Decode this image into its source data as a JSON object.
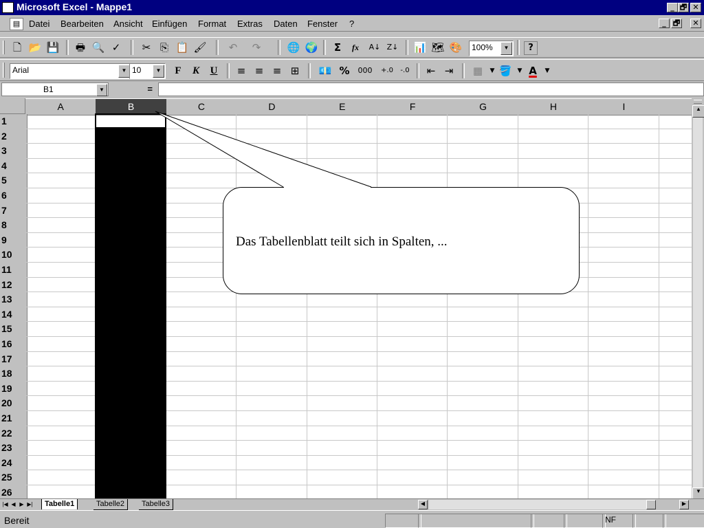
{
  "window": {
    "title": "Microsoft Excel - Mappe1",
    "controls": [
      "_",
      "🗗",
      "✕"
    ]
  },
  "menubar": {
    "items": [
      {
        "label": "Datei"
      },
      {
        "label": "Bearbeiten"
      },
      {
        "label": "Ansicht"
      },
      {
        "label": "Einfügen"
      },
      {
        "label": "Format"
      },
      {
        "label": "Extras"
      },
      {
        "label": "Daten"
      },
      {
        "label": "Fenster"
      },
      {
        "label": "?"
      }
    ]
  },
  "standard_toolbar": {
    "zoom": "100%",
    "autosum_symbol": "Σ",
    "function_symbol": "fx"
  },
  "format_toolbar": {
    "font": "Arial",
    "size": "10",
    "bold": "F",
    "italic": "K",
    "underline": "U",
    "percent": "%",
    "thousands": "000",
    "font_color_letter": "A"
  },
  "formula_bar": {
    "cell_ref": "B1",
    "equals": "="
  },
  "grid": {
    "columns": [
      "A",
      "B",
      "C",
      "D",
      "E",
      "F",
      "G",
      "H",
      "I"
    ],
    "rows": [
      "1",
      "2",
      "3",
      "4",
      "5",
      "6",
      "7",
      "8",
      "9",
      "10",
      "11",
      "12",
      "13",
      "14",
      "15",
      "16",
      "17",
      "18",
      "19",
      "20",
      "21",
      "22",
      "23",
      "24",
      "25",
      "26"
    ],
    "selected_column": "B"
  },
  "sheets": {
    "tabs": [
      "Tabelle1",
      "Tabelle2",
      "Tabelle3"
    ],
    "active": "Tabelle1"
  },
  "statusbar": {
    "text": "Bereit",
    "numlock": "NF"
  },
  "callout": {
    "text": "Das Tabellenblatt teilt sich in Spalten, ..."
  },
  "colors": {
    "titlebar": "#000080",
    "chrome": "#c0c0c0",
    "selection": "#000000"
  }
}
